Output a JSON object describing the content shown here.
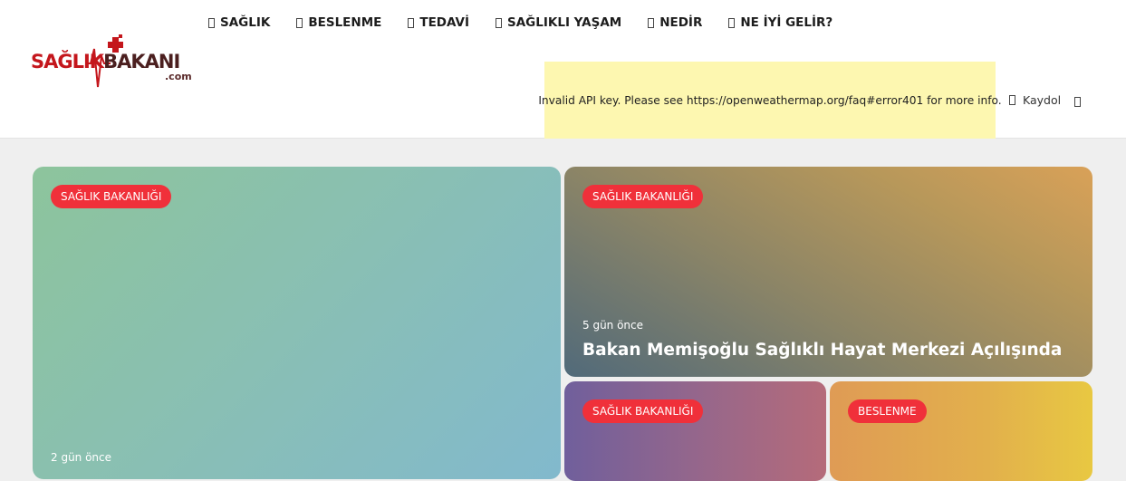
{
  "brand": {
    "logo_main": "SAĞLIKBAKANI",
    "logo_main_first": "SAĞLIK",
    "logo_main_second": "BAKANI",
    "logo_suffix": ".com",
    "colors": {
      "red": "#c4161c",
      "dark": "#4b1f1f"
    }
  },
  "nav": {
    "items": [
      {
        "label": "SAĞLIK",
        "icon": "category-icon"
      },
      {
        "label": "BESLENME",
        "icon": "category-icon"
      },
      {
        "label": "TEDAVİ",
        "icon": "category-icon"
      },
      {
        "label": "SAĞLIKLI YAŞAM",
        "icon": "category-icon"
      },
      {
        "label": "NEDİR",
        "icon": "category-icon"
      },
      {
        "label": "NE İYİ GELİR?",
        "icon": "category-icon"
      }
    ]
  },
  "weather": {
    "message": "Invalid API key. Please see https://openweathermap.org/faq#error401 for more info.",
    "background": "#fdf7b0"
  },
  "user_menu": {
    "register_label": "Kaydol",
    "register_icon": "user-icon",
    "search_icon": "search-icon"
  },
  "featured": {
    "badge_color": "#f0303a",
    "cards": [
      {
        "category": "SAĞLIK BAKANLIĞI",
        "date": "2 gün önce",
        "title": ""
      },
      {
        "category": "SAĞLIK BAKANLIĞI",
        "date": "5 gün önce",
        "title": "Bakan Memişoğlu Sağlıklı Hayat Merkezi Açılışında"
      },
      {
        "category": "SAĞLIK BAKANLIĞI",
        "date": "",
        "title": ""
      },
      {
        "category": "BESLENME",
        "date": "",
        "title": ""
      }
    ]
  }
}
